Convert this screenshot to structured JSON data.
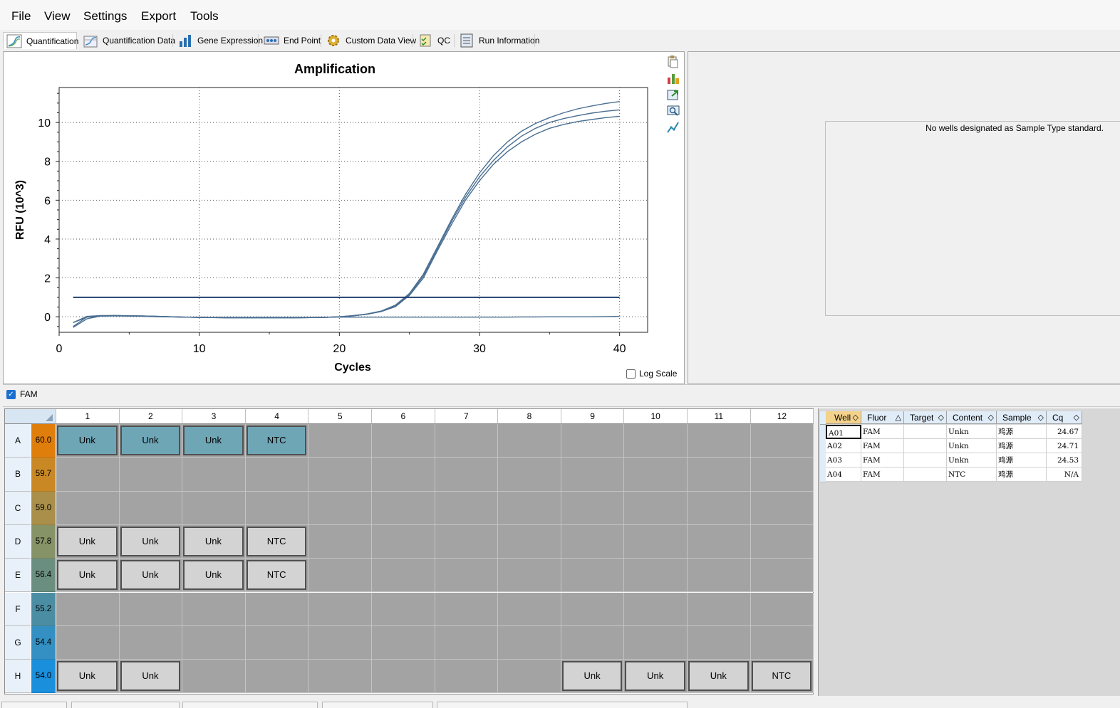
{
  "menu": [
    "File",
    "View",
    "Settings",
    "Export",
    "Tools"
  ],
  "tabs": [
    {
      "label": "Quantification",
      "icon": "amplification-curve-icon",
      "active": true
    },
    {
      "label": "Quantification Data",
      "icon": "quantification-data-icon",
      "active": false
    },
    {
      "label": "Gene Expression",
      "icon": "bar-chart-icon",
      "active": false
    },
    {
      "label": "End Point",
      "icon": "end-point-icon",
      "active": false
    },
    {
      "label": "Custom Data View",
      "icon": "gear-icon",
      "active": false
    },
    {
      "label": "QC",
      "icon": "qc-checklist-icon",
      "active": false
    },
    {
      "label": "Run Information",
      "icon": "run-info-icon",
      "active": false
    }
  ],
  "chart_tools": [
    "copy-icon",
    "chart-options-icon",
    "export-icon",
    "zoom-icon",
    "curve-tool-icon"
  ],
  "chart_data": {
    "type": "line",
    "title": "Amplification",
    "xlabel": "Cycles",
    "ylabel": "RFU (10^3)",
    "xlim": [
      0,
      42
    ],
    "ylim": [
      -0.8,
      11.8
    ],
    "xticks": [
      0,
      10,
      20,
      30,
      40
    ],
    "yticks": [
      0,
      2,
      4,
      6,
      8,
      10
    ],
    "grid": true,
    "x": [
      1,
      2,
      3,
      4,
      5,
      6,
      7,
      8,
      9,
      10,
      11,
      12,
      13,
      14,
      15,
      16,
      17,
      18,
      19,
      20,
      21,
      22,
      23,
      24,
      25,
      26,
      27,
      28,
      29,
      30,
      31,
      32,
      33,
      34,
      35,
      36,
      37,
      38,
      39,
      40
    ],
    "series": [
      {
        "values": [
          -0.5,
          0.0,
          0.05,
          0.06,
          0.05,
          0.04,
          0.02,
          0.0,
          -0.02,
          -0.03,
          -0.04,
          -0.05,
          -0.05,
          -0.05,
          -0.05,
          -0.05,
          -0.05,
          -0.04,
          -0.03,
          0.0,
          0.06,
          0.15,
          0.3,
          0.6,
          1.2,
          2.2,
          3.6,
          5.0,
          6.3,
          7.4,
          8.3,
          9.0,
          9.55,
          9.95,
          10.25,
          10.5,
          10.7,
          10.85,
          10.98,
          11.08
        ],
        "color": "#4a6f92"
      },
      {
        "values": [
          -0.3,
          0.02,
          0.06,
          0.06,
          0.05,
          0.04,
          0.02,
          0.0,
          -0.02,
          -0.03,
          -0.04,
          -0.05,
          -0.05,
          -0.05,
          -0.05,
          -0.05,
          -0.05,
          -0.04,
          -0.03,
          0.0,
          0.05,
          0.13,
          0.28,
          0.55,
          1.15,
          2.1,
          3.5,
          4.9,
          6.15,
          7.2,
          8.05,
          8.75,
          9.3,
          9.7,
          10.0,
          10.2,
          10.35,
          10.48,
          10.58,
          10.65
        ],
        "color": "#4a6f92"
      },
      {
        "values": [
          -0.55,
          -0.1,
          0.04,
          0.06,
          0.05,
          0.04,
          0.02,
          0.0,
          -0.02,
          -0.03,
          -0.04,
          -0.05,
          -0.05,
          -0.05,
          -0.05,
          -0.05,
          -0.05,
          -0.04,
          -0.03,
          0.0,
          0.05,
          0.13,
          0.27,
          0.52,
          1.1,
          2.0,
          3.4,
          4.75,
          6.0,
          7.0,
          7.85,
          8.5,
          9.0,
          9.4,
          9.7,
          9.9,
          10.05,
          10.15,
          10.25,
          10.32
        ],
        "color": "#4a6f92"
      },
      {
        "values": [
          -0.3,
          -0.02,
          0.03,
          0.04,
          0.03,
          0.02,
          0.0,
          -0.01,
          -0.02,
          -0.03,
          -0.03,
          -0.03,
          -0.03,
          -0.03,
          -0.03,
          -0.03,
          -0.03,
          -0.03,
          -0.02,
          -0.02,
          -0.02,
          -0.02,
          -0.02,
          -0.02,
          -0.02,
          -0.02,
          -0.02,
          -0.02,
          -0.02,
          -0.02,
          -0.02,
          -0.02,
          -0.01,
          -0.01,
          0.0,
          0.0,
          0.0,
          0.0,
          0.01,
          0.02
        ],
        "color": "#4a6f92"
      }
    ],
    "threshold": {
      "value": 1.0,
      "x": [
        1,
        40
      ],
      "color": "#1f3f6e"
    }
  },
  "log_scale_label": "Log Scale",
  "right_panel_message": "No wells designated as Sample Type standard.",
  "fluor_filter": {
    "label": "FAM",
    "checked": true
  },
  "plate": {
    "columns": [
      "1",
      "2",
      "3",
      "4",
      "5",
      "6",
      "7",
      "8",
      "9",
      "10",
      "11",
      "12"
    ],
    "rows": [
      {
        "label": "A",
        "temp": "60.0",
        "temp_color": "#e07e0c",
        "wells": {
          "1": "Unk",
          "2": "Unk",
          "3": "Unk",
          "4": "NTC"
        },
        "selected": true
      },
      {
        "label": "B",
        "temp": "59.7",
        "temp_color": "#c98824",
        "wells": {},
        "selected": false
      },
      {
        "label": "C",
        "temp": "59.0",
        "temp_color": "#a98f4a",
        "wells": {},
        "selected": false
      },
      {
        "label": "D",
        "temp": "57.8",
        "temp_color": "#859366",
        "wells": {
          "1": "Unk",
          "2": "Unk",
          "3": "Unk",
          "4": "NTC"
        },
        "selected": false
      },
      {
        "label": "E",
        "temp": "56.4",
        "temp_color": "#6a8e80",
        "wells": {
          "1": "Unk",
          "2": "Unk",
          "3": "Unk",
          "4": "NTC"
        },
        "selected": false
      },
      {
        "label": "F",
        "temp": "55.2",
        "temp_color": "#4b8ea3",
        "wells": {},
        "selected": false
      },
      {
        "label": "G",
        "temp": "54.4",
        "temp_color": "#3490c2",
        "wells": {},
        "selected": false
      },
      {
        "label": "H",
        "temp": "54.0",
        "temp_color": "#1a8fdc",
        "wells": {
          "1": "Unk",
          "2": "Unk",
          "9": "Unk",
          "10": "Unk",
          "11": "Unk",
          "12": "NTC"
        },
        "selected": false
      }
    ]
  },
  "data_table": {
    "headers": [
      "Well",
      "Fluor",
      "Target",
      "Content",
      "Sample",
      "Cq"
    ],
    "rows": [
      [
        "A01",
        "FAM",
        "",
        "Unkn",
        "鸡源",
        "24.67"
      ],
      [
        "A02",
        "FAM",
        "",
        "Unkn",
        "鸡源",
        "24.71"
      ],
      [
        "A03",
        "FAM",
        "",
        "Unkn",
        "鸡源",
        "24.53"
      ],
      [
        "A04",
        "FAM",
        "",
        "NTC",
        "鸡源",
        "N/A"
      ]
    ]
  }
}
